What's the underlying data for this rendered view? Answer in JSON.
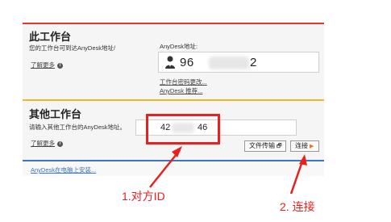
{
  "this_desk": {
    "title": "此工作台",
    "description": "您的工作台可到达AnyDesk地址/",
    "learn_more": "了解更多",
    "address_label": "AnyDesk地址:",
    "address_prefix": "96",
    "address_suffix": "2",
    "change_password_link": "工作台密码更改...",
    "recommend_link": "AnyDesk 推荐..."
  },
  "other_desk": {
    "title": "其他工作台",
    "description": "请输入其他工作台的AnyDesk地址。",
    "learn_more": "了解更多",
    "input_prefix": "42",
    "input_suffix": "46",
    "file_transfer_button": "文件传输",
    "connect_button": "连接"
  },
  "install": {
    "link": "AnyDesk在电脑上安装..."
  },
  "annotations": {
    "peer_id": "1.对方ID",
    "connect": "2. 连接",
    "color": "#e8201f"
  },
  "colors": {
    "this_desk_accent": "#e8342f",
    "other_desk_accent": "#f3b52e",
    "install_accent": "#3b74c9"
  },
  "icons": {
    "user": "person-icon",
    "info": "info-icon",
    "file_transfer": "file-transfer-icon",
    "connect": "play-arrow-icon"
  }
}
